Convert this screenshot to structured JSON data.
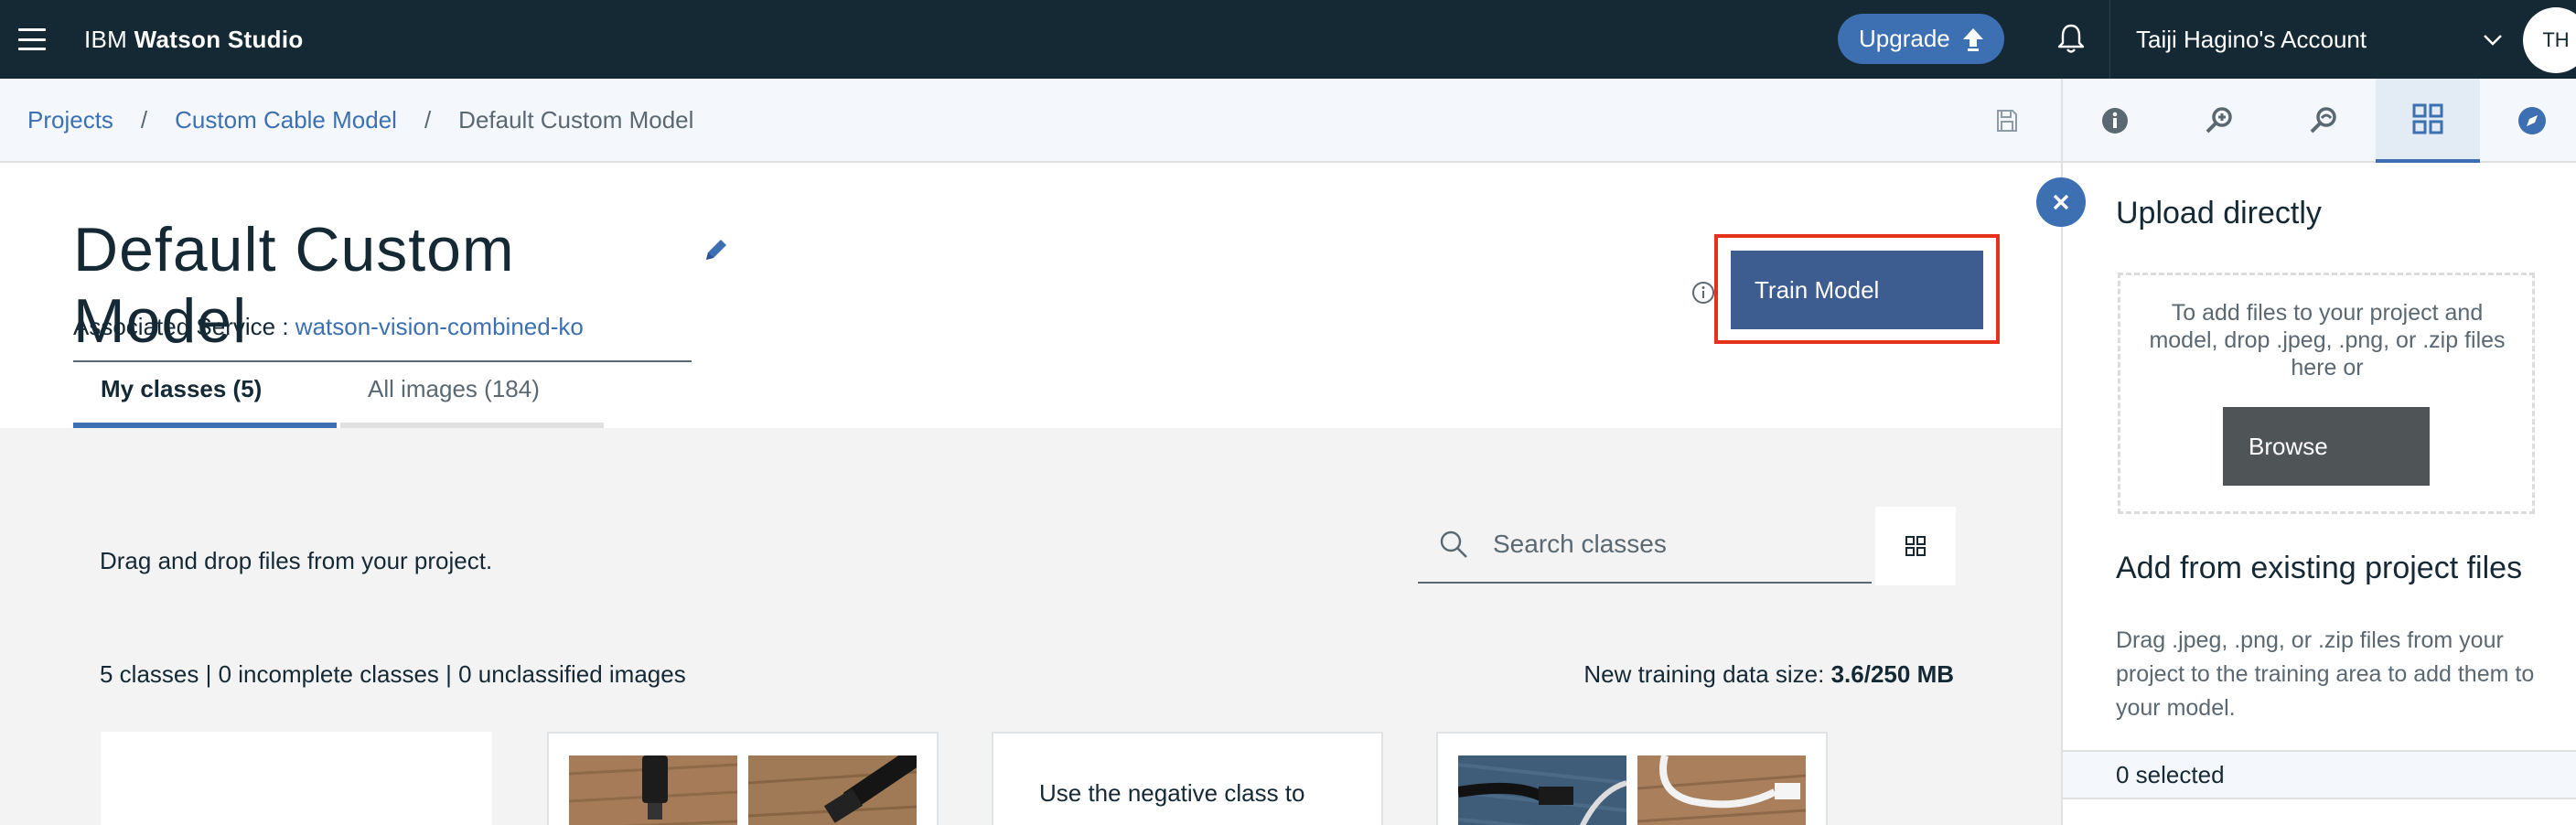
{
  "topbar": {
    "brand_prefix": "IBM",
    "brand_name": "Watson Studio",
    "upgrade_label": "Upgrade",
    "account_name": "Taiji Hagino's Account",
    "avatar_initials": "TH"
  },
  "breadcrumb": {
    "items": [
      "Projects",
      "Custom Cable Model"
    ],
    "separator": "/",
    "current": "Default Custom Model"
  },
  "right_toolbar": {
    "icons": [
      "info-icon",
      "find-and-add-data-icon",
      "notebook-icon",
      "data-assets-icon",
      "explore-icon"
    ],
    "active": "data-assets-icon"
  },
  "header": {
    "title": "Default Custom Model",
    "assoc_label": "Associated Service :",
    "assoc_link": "watson-vision-combined-ko",
    "train_label": "Train Model"
  },
  "tabs": [
    {
      "label": "My classes (5)",
      "active": true
    },
    {
      "label": "All images (184)",
      "active": false
    }
  ],
  "content": {
    "drag_text": "Drag and drop files from your project.",
    "search_placeholder": "Search classes",
    "counts": "5 classes | 0 incomplete classes | 0 unclassified images",
    "size_label": "New training data size:",
    "size_value": "3.6/250 MB",
    "negative_text": "Use the negative class to"
  },
  "panel": {
    "upload_title": "Upload directly",
    "dropzone_text": "To add files to your project and model, drop .jpeg, .png, or .zip files here or",
    "browse_label": "Browse",
    "existing_title": "Add from existing project files",
    "existing_desc": "Drag .jpeg, .png, or .zip files from your project to the training area to add them to your model.",
    "selected": "0 selected"
  },
  "colors": {
    "topbar_bg": "#152935",
    "accent": "#3d70b2",
    "train_button": "#3d5c8f",
    "highlight_box": "#e5331b"
  }
}
